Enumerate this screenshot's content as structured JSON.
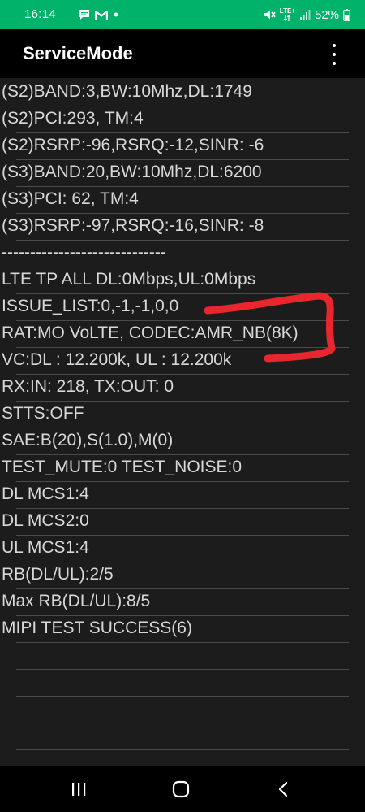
{
  "status_bar": {
    "time": "16:14",
    "network_type": "LTE+",
    "battery_percent": "52%",
    "icons": [
      "chat-icon",
      "gmail-icon",
      "notification-dot-icon",
      "mute-vibrate-icon",
      "lte-plus-icon",
      "signal-bars-icon",
      "battery-icon"
    ]
  },
  "app_bar": {
    "title": "ServiceMode",
    "menu_icon": "overflow-menu-icon"
  },
  "rows": [
    "(S2)BAND:3,BW:10Mhz,DL:1749",
    "(S2)PCI:293, TM:4",
    "(S2)RSRP:-96,RSRQ:-12,SINR: -6",
    "(S3)BAND:20,BW:10Mhz,DL:6200",
    "(S3)PCI: 62, TM:4",
    "(S3)RSRP:-97,RSRQ:-16,SINR: -8",
    "-----------------------------",
    "LTE TP ALL DL:0Mbps,UL:0Mbps",
    "ISSUE_LIST:0,-1,-1,0,0",
    "RAT:MO VoLTE, CODEC:AMR_NB(8K)",
    "VC:DL : 12.200k, UL : 12.200k",
    "RX:IN: 218, TX:OUT:   0",
    "STTS:OFF",
    "SAE:B(20),S(1.0),M(0)",
    "TEST_MUTE:0 TEST_NOISE:0",
    "DL MCS1:4",
    "DL MCS2:0",
    "UL MCS1:4",
    "RB(DL/UL):2/5",
    "Max RB(DL/UL):8/5",
    "MIPI TEST SUCCESS(6)",
    "",
    "",
    "",
    ""
  ],
  "colors": {
    "status_bar": "#00b26a",
    "background": "#1c1c1c",
    "app_bar": "#000000",
    "text": "#d8d8d8",
    "divider": "#4a4a4a",
    "annotation": "#e8262e"
  },
  "nav_bar": {
    "icons": [
      "recent-apps-icon",
      "home-icon",
      "back-icon"
    ]
  }
}
